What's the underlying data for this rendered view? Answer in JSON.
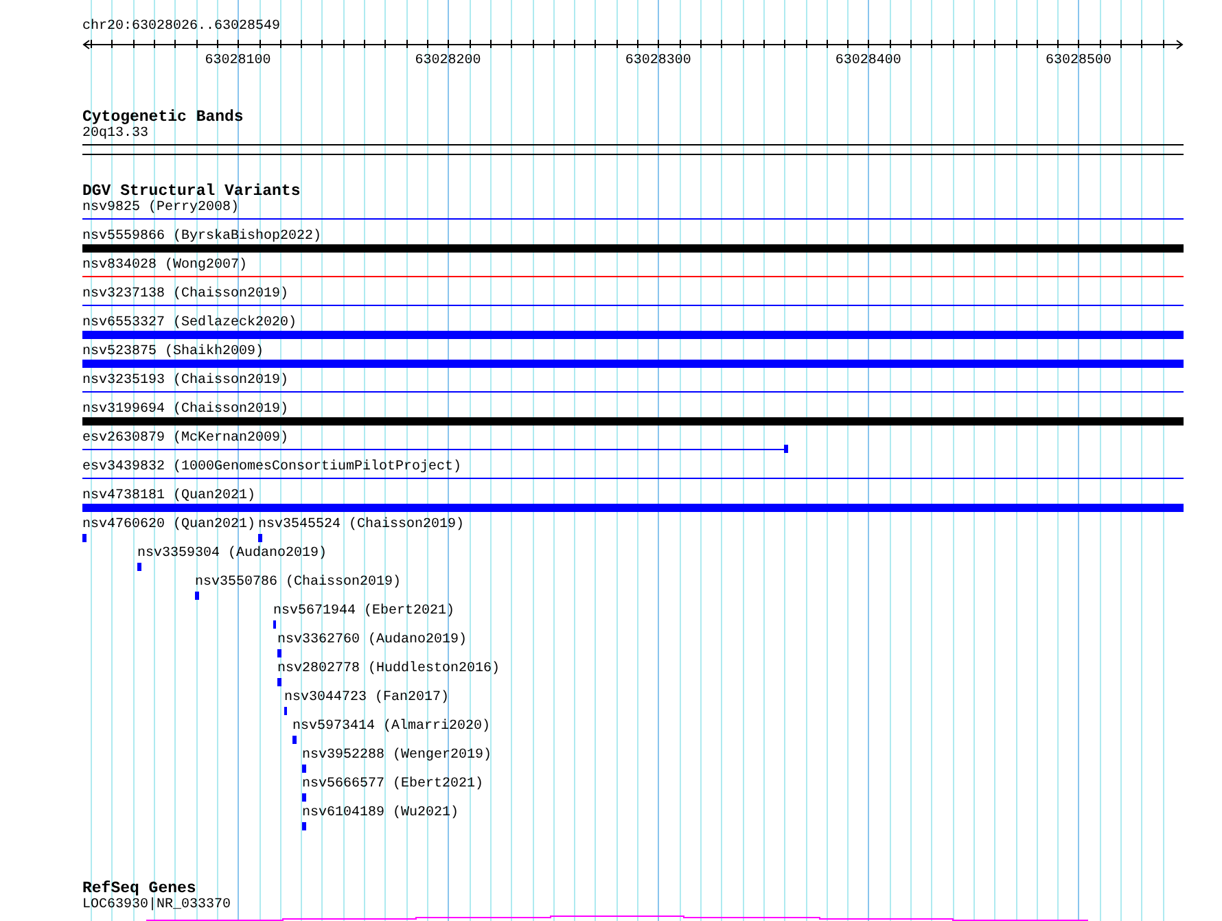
{
  "ruler": {
    "location": "chr20:63028026..63028549",
    "ticks": [
      "63028100",
      "63028200",
      "63028300",
      "63028400",
      "63028500"
    ]
  },
  "cytogenetic_bands": {
    "title": "Cytogenetic Bands",
    "band": "20q13.33"
  },
  "dgv_structural_variants": {
    "title": "DGV Structural Variants",
    "full_rows": [
      {
        "label": "nsv9825 (Perry2008)",
        "kind": "line",
        "color": "#0000ff"
      },
      {
        "label": "nsv5559866 (ByrskaBishop2022)",
        "kind": "bar",
        "color": "#000000"
      },
      {
        "label": "nsv834028 (Wong2007)",
        "kind": "line",
        "color": "#ff0000"
      },
      {
        "label": "nsv3237138 (Chaisson2019)",
        "kind": "line",
        "color": "#0000ff"
      },
      {
        "label": "nsv6553327 (Sedlazeck2020)",
        "kind": "bar",
        "color": "#0000ff"
      },
      {
        "label": "nsv523875 (Shaikh2009)",
        "kind": "bar",
        "color": "#0000ff"
      },
      {
        "label": "nsv3235193 (Chaisson2019)",
        "kind": "line",
        "color": "#0000ff"
      },
      {
        "label": "nsv3199694 (Chaisson2019)",
        "kind": "bar",
        "color": "#000000"
      },
      {
        "label": "esv2630879 (McKernan2009)",
        "kind": "line-end",
        "color": "#0000ff"
      },
      {
        "label": "esv3439832 (1000GenomesConsortiumPilotProject)",
        "kind": "line",
        "color": "#0000ff"
      },
      {
        "label": "nsv4738181 (Quan2021)",
        "kind": "bar",
        "color": "#0000ff"
      }
    ],
    "small_rows": [
      {
        "features": [
          {
            "label": "nsv4760620 (Quan2021)"
          },
          {
            "label": "nsv3545524 (Chaisson2019)"
          }
        ]
      },
      {
        "features": [
          {
            "label": "nsv3359304 (Audano2019)"
          }
        ]
      },
      {
        "features": [
          {
            "label": "nsv3550786 (Chaisson2019)"
          }
        ]
      },
      {
        "features": [
          {
            "label": "nsv5671944 (Ebert2021)"
          }
        ]
      },
      {
        "features": [
          {
            "label": "nsv3362760 (Audano2019)"
          }
        ]
      },
      {
        "features": [
          {
            "label": "nsv2802778 (Huddleston2016)"
          }
        ]
      },
      {
        "features": [
          {
            "label": "nsv3044723 (Fan2017)"
          }
        ]
      },
      {
        "features": [
          {
            "label": "nsv5973414 (Almarri2020)"
          }
        ]
      },
      {
        "features": [
          {
            "label": "nsv3952288 (Wenger2019)"
          }
        ]
      },
      {
        "features": [
          {
            "label": "nsv5666577 (Ebert2021)"
          }
        ]
      },
      {
        "features": [
          {
            "label": "nsv6104189 (Wu2021)"
          }
        ]
      }
    ]
  },
  "refseq_genes": {
    "title": "RefSeq Genes",
    "gene": "LOC63930|NR_033370"
  }
}
